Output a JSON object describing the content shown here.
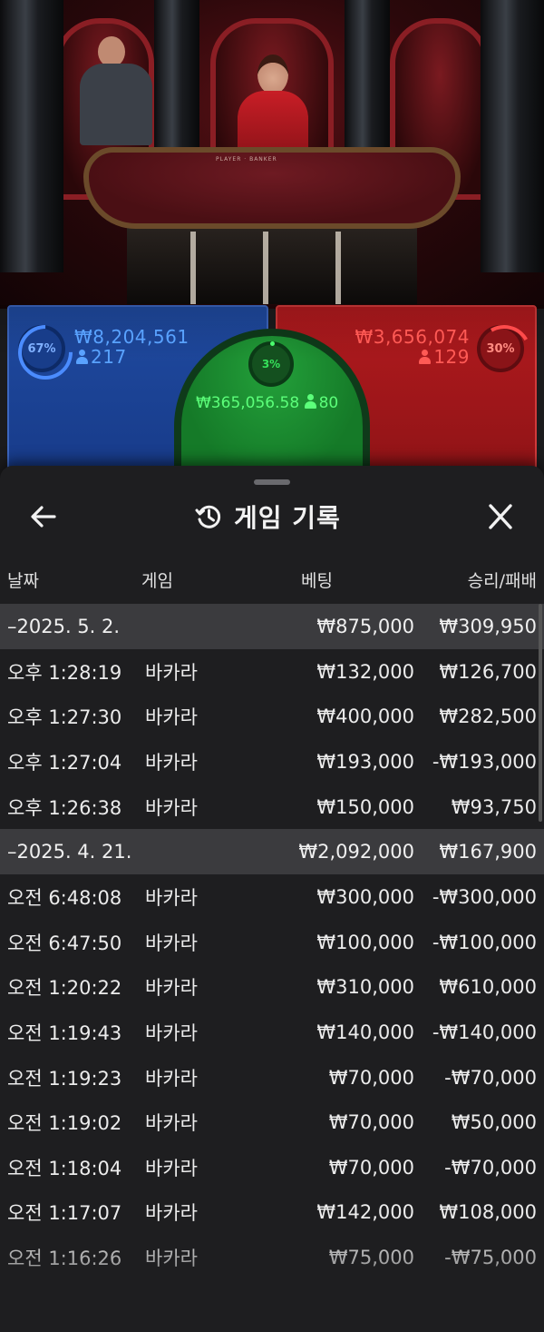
{
  "bets": {
    "player": {
      "percent": "67%",
      "amount": "₩8,204,561",
      "players": "217"
    },
    "tie": {
      "percent": "3%",
      "amount": "₩365,056.58",
      "players": "80"
    },
    "banker": {
      "percent": "30%",
      "amount": "₩3,656,074",
      "players": "129"
    },
    "table_label": "PLAYER · BANKER"
  },
  "sheet": {
    "title": "게임 기록",
    "columns": {
      "date": "날짜",
      "game": "게임",
      "bet": "베팅",
      "win_loss": "승리/패배"
    }
  },
  "history": [
    {
      "date": "–2025. 5. 2.",
      "bet": "₩875,000",
      "win_loss": "₩309,950",
      "rows": [
        {
          "time": "오후 1:28:19",
          "game": "바카라",
          "bet": "₩132,000",
          "win_loss": "₩126,700"
        },
        {
          "time": "오후 1:27:30",
          "game": "바카라",
          "bet": "₩400,000",
          "win_loss": "₩282,500"
        },
        {
          "time": "오후 1:27:04",
          "game": "바카라",
          "bet": "₩193,000",
          "win_loss": "-₩193,000"
        },
        {
          "time": "오후 1:26:38",
          "game": "바카라",
          "bet": "₩150,000",
          "win_loss": "₩93,750"
        }
      ]
    },
    {
      "date": "–2025. 4. 21.",
      "bet": "₩2,092,000",
      "win_loss": "₩167,900",
      "rows": [
        {
          "time": "오전 6:48:08",
          "game": "바카라",
          "bet": "₩300,000",
          "win_loss": "-₩300,000"
        },
        {
          "time": "오전 6:47:50",
          "game": "바카라",
          "bet": "₩100,000",
          "win_loss": "-₩100,000"
        },
        {
          "time": "오전 1:20:22",
          "game": "바카라",
          "bet": "₩310,000",
          "win_loss": "₩610,000"
        },
        {
          "time": "오전 1:19:43",
          "game": "바카라",
          "bet": "₩140,000",
          "win_loss": "-₩140,000"
        },
        {
          "time": "오전 1:19:23",
          "game": "바카라",
          "bet": "₩70,000",
          "win_loss": "-₩70,000"
        },
        {
          "time": "오전 1:19:02",
          "game": "바카라",
          "bet": "₩70,000",
          "win_loss": "₩50,000"
        },
        {
          "time": "오전 1:18:04",
          "game": "바카라",
          "bet": "₩70,000",
          "win_loss": "-₩70,000"
        },
        {
          "time": "오전 1:17:07",
          "game": "바카라",
          "bet": "₩142,000",
          "win_loss": "₩108,000"
        },
        {
          "time": "오전 1:16:26",
          "game": "바카라",
          "bet": "₩75,000",
          "win_loss": "-₩75,000"
        }
      ]
    }
  ],
  "icons": {
    "back": "arrow-left-icon",
    "history": "history-clock-icon",
    "close": "close-icon",
    "person": "person-icon"
  },
  "colors": {
    "player": "#1f4aa0",
    "banker": "#b21a1e",
    "tie": "#23a03a",
    "sheet_bg": "#1e1e20",
    "group_bg": "#3b3b3e"
  }
}
